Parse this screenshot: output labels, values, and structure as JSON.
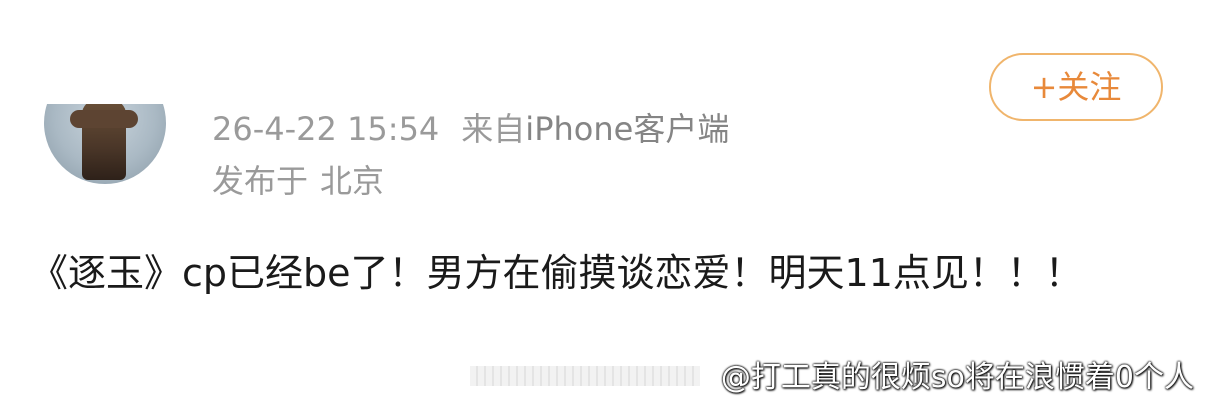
{
  "post": {
    "timestamp": "26-4-22 15:54",
    "via_prefix": "来自",
    "via_client": "iPhone客户端",
    "location_label": "发布于",
    "location": "北京",
    "content": "《逐玉》cp已经be了！男方在偷摸谈恋爱！明天11点见！！！"
  },
  "follow_button": {
    "label": "+关注"
  },
  "watermark": {
    "text": "@打工真的很烦so将在浪惯着0个人"
  },
  "colors": {
    "accent": "#e8893a",
    "meta_text": "#9a9a9a",
    "body_text": "#1a1a1a"
  },
  "icons": {
    "avatar": "user-avatar-image"
  }
}
